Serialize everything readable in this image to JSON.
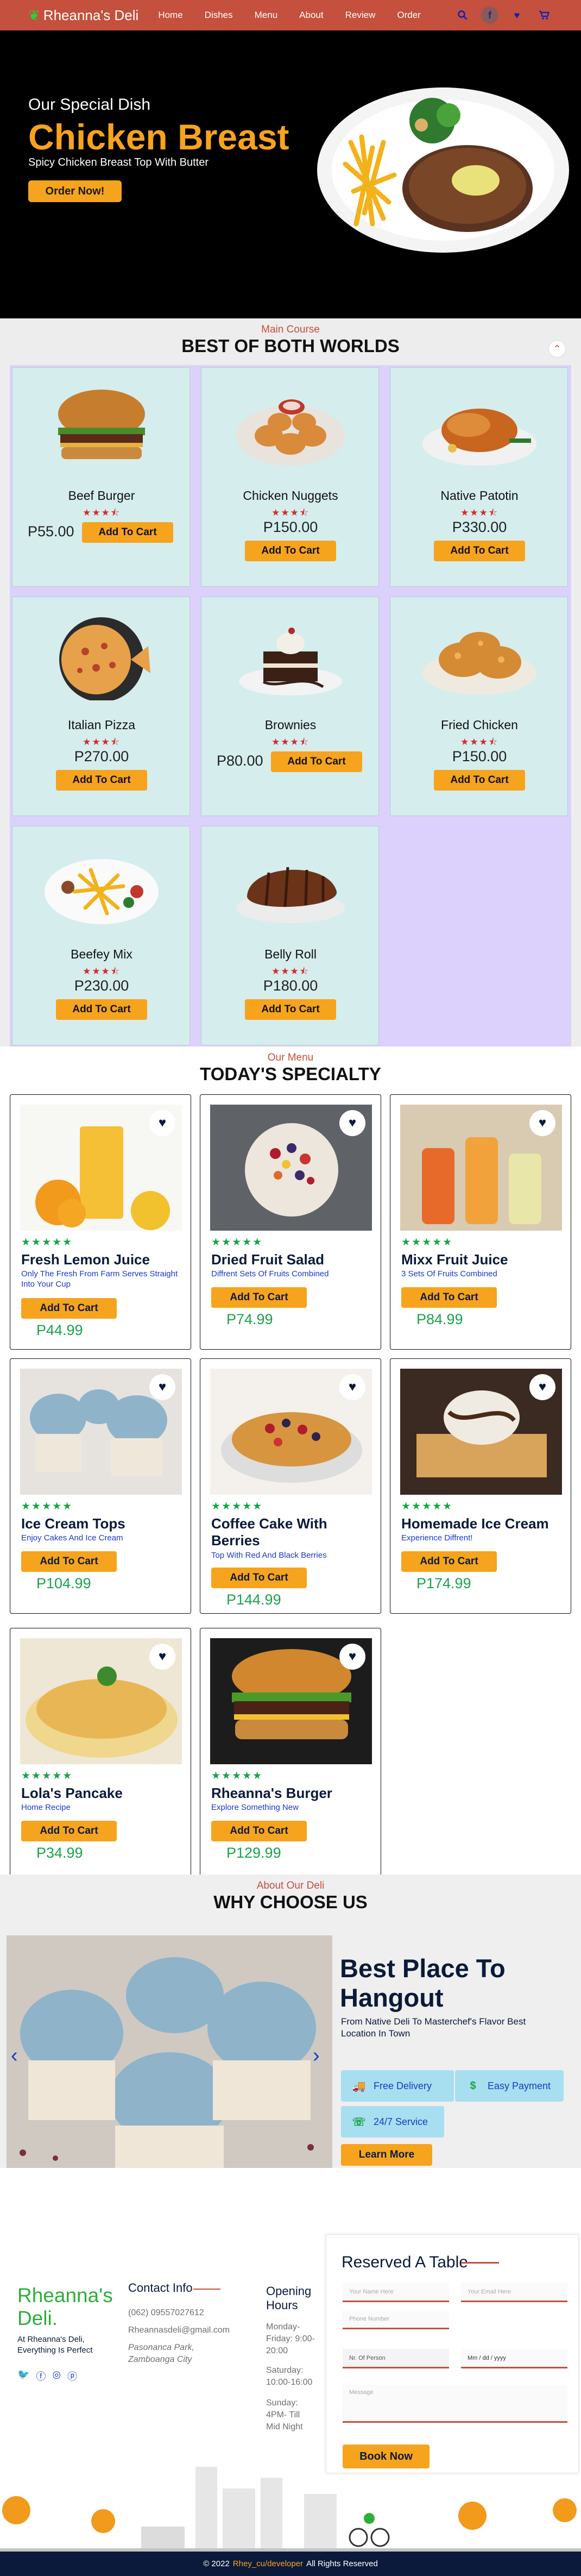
{
  "nav": {
    "brand": "Rheanna's Deli",
    "items": [
      "Home",
      "Dishes",
      "Menu",
      "About",
      "Review",
      "Order"
    ]
  },
  "hero": {
    "subtitle": "Our Special Dish",
    "title": "Chicken Breast",
    "description": "Spicy Chicken Breast Top With Butter",
    "button": "Order Now!"
  },
  "main_course": {
    "kicker": "Main Course",
    "title": "BEST OF BOTH WORLDS",
    "items": [
      {
        "name": "Beef Burger",
        "price": "P55.00",
        "cart": "Add To Cart",
        "rating": 3.5
      },
      {
        "name": "Chicken Nuggets",
        "price": "P150.00",
        "cart": "Add To Cart",
        "rating": 3.5
      },
      {
        "name": "Native Patotin",
        "price": "P330.00",
        "cart": "Add To Cart",
        "rating": 3.5
      },
      {
        "name": "Italian Pizza",
        "price": "P270.00",
        "cart": "Add To Cart",
        "rating": 3.5
      },
      {
        "name": "Brownies",
        "price": "P80.00",
        "cart": "Add To Cart",
        "rating": 3.5
      },
      {
        "name": "Fried Chicken",
        "price": "P150.00",
        "cart": "Add To Cart",
        "rating": 3.5
      },
      {
        "name": "Beefey Mix",
        "price": "P230.00",
        "cart": "Add To Cart",
        "rating": 3.5
      },
      {
        "name": "Belly Roll",
        "price": "P180.00",
        "cart": "Add To Cart",
        "rating": 3.5
      }
    ]
  },
  "specialty": {
    "kicker": "Our Menu",
    "title": "TODAY'S SPECIALTY",
    "items": [
      {
        "name": "Fresh Lemon Juice",
        "desc": "Only The Fresh From Farm Serves Straight Into Your Cup",
        "price": "P44.99",
        "cart": "Add To Cart",
        "rating": 5
      },
      {
        "name": "Dried Fruit Salad",
        "desc": "Diffrent Sets Of Fruits Combined",
        "price": "P74.99",
        "cart": "Add To Cart",
        "rating": 5
      },
      {
        "name": "Mixx Fruit Juice",
        "desc": "3 Sets Of Fruits Combined",
        "price": "P84.99",
        "cart": "Add To Cart",
        "rating": 5
      },
      {
        "name": "Ice Cream Tops",
        "desc": "Enjoy Cakes And Ice Cream",
        "price": "P104.99",
        "cart": "Add To Cart",
        "rating": 5
      },
      {
        "name": "Coffee Cake With Berries",
        "desc": "Top With Red And Black Berries",
        "price": "P144.99",
        "cart": "Add To Cart",
        "rating": 5
      },
      {
        "name": "Homemade Ice Cream",
        "desc": "Experience Diffrent!",
        "price": "P174.99",
        "cart": "Add To Cart",
        "rating": 5
      },
      {
        "name": "Lola's Pancake",
        "desc": "Home Recipe",
        "price": "P34.99",
        "cart": "Add To Cart",
        "rating": 5
      },
      {
        "name": "Rheanna's Burger",
        "desc": "Explore Something New",
        "price": "P129.99",
        "cart": "Add To Cart",
        "rating": 5
      }
    ]
  },
  "why": {
    "kicker": "About Our Deli",
    "title": "WHY CHOOSE US",
    "heading": "Best Place To Hangout",
    "text": "From Native Deli To Masterchef's Flavor Best Location In Town",
    "features": [
      "Free Delivery",
      "Easy Payment",
      "24/7 Service"
    ],
    "button": "Learn More"
  },
  "footer": {
    "brand": "Rheanna's Deli.",
    "tagline": "At Rheanna's Deli, Everything Is Perfect",
    "contact_title": "Contact Info",
    "phone": "(062) 09557027612",
    "email": "Rheannasdeli@gmail.com",
    "address": "Pasonanca Park, Zamboanga City",
    "hours_title": "Opening Hours",
    "hours": [
      "Monday-Friday: 9:00-20:00",
      "Saturday: 10:00-16:00",
      "Sunday: 4PM- Till Mid Night"
    ],
    "reserve_title": "Reserved A Table",
    "placeholders": [
      "Your Name Here",
      "Your Email Here",
      "Phone Number",
      "Nr. Of Person",
      "Mm / dd / yyyy",
      "Message"
    ],
    "book_button": "Book Now",
    "copyright_pre": "© 2022",
    "copyright_handle": "Rhey_cu/developer",
    "copyright_post": "All Rights Reserved"
  },
  "colors": {
    "nav": "#c4503d",
    "accent": "#f6a31e",
    "card": "#d5eded",
    "grid": "#dcd1fc",
    "green": "#1aa34a",
    "navy": "#0b1a3a"
  }
}
